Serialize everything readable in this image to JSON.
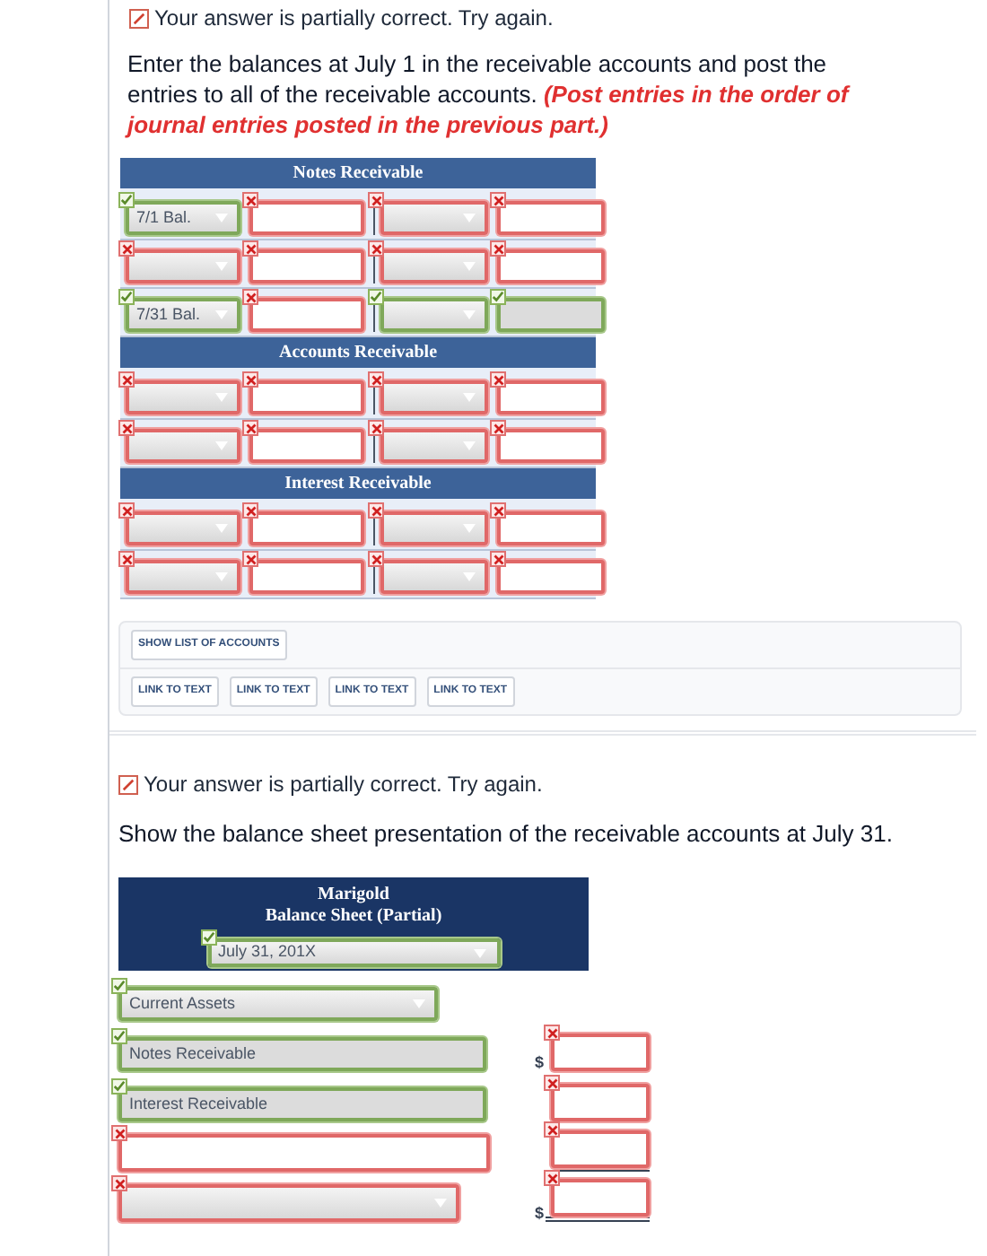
{
  "top_feedback": "Your answer is partially correct.  Try again.",
  "instructions": "Enter the balances at July 1 in the receivable accounts and post the entries to all of the receivable accounts. **(Post entries in the order of journal entries posted in the previous part.)**",
  "ledgers": [
    {
      "title": "Notes Receivable",
      "rows": [
        [
          {
            "kind": "select",
            "value": "7/1 Bal.",
            "correct": true
          },
          {
            "kind": "input",
            "correct": false
          },
          {
            "kind": "select",
            "correct": false
          },
          {
            "kind": "input",
            "correct": false
          }
        ],
        [
          {
            "kind": "select",
            "correct": false
          },
          {
            "kind": "input",
            "correct": false
          },
          {
            "kind": "select",
            "correct": false
          },
          {
            "kind": "input",
            "correct": false
          }
        ],
        [
          {
            "kind": "select",
            "value": "7/31 Bal.",
            "correct": true
          },
          {
            "kind": "input",
            "correct": false
          },
          {
            "kind": "select",
            "correct": true
          },
          {
            "kind": "input",
            "correct": true
          }
        ]
      ]
    },
    {
      "title": "Accounts Receivable",
      "rows": [
        [
          {
            "kind": "select",
            "correct": false
          },
          {
            "kind": "input",
            "correct": false
          },
          {
            "kind": "select",
            "correct": false
          },
          {
            "kind": "input",
            "correct": false
          }
        ],
        [
          {
            "kind": "select",
            "correct": false
          },
          {
            "kind": "input",
            "correct": false
          },
          {
            "kind": "select",
            "correct": false
          },
          {
            "kind": "input",
            "correct": false
          }
        ]
      ]
    },
    {
      "title": "Interest Receivable",
      "rows": [
        [
          {
            "kind": "select",
            "correct": false
          },
          {
            "kind": "input",
            "correct": false
          },
          {
            "kind": "select",
            "correct": false
          },
          {
            "kind": "input",
            "correct": false
          }
        ],
        [
          {
            "kind": "select",
            "correct": false
          },
          {
            "kind": "input",
            "correct": false
          },
          {
            "kind": "select",
            "correct": false
          },
          {
            "kind": "input",
            "correct": false
          }
        ]
      ]
    }
  ],
  "tool_buttons": [
    [
      "SHOW LIST OF ACCOUNTS"
    ],
    [
      "LINK TO TEXT",
      "LINK TO TEXT",
      "LINK TO TEXT",
      "LINK TO TEXT"
    ]
  ],
  "feedback": "Your answer is partially correct.  Try again.",
  "question": "Show the balance sheet presentation of the receivable accounts at July 31.",
  "balance_sheet": {
    "company": "Marigold",
    "title": "Balance Sheet (Partial)",
    "date": {
      "value": "July 31, 201X",
      "correct": true
    },
    "rows": [
      {
        "kind": "select",
        "value": "Current Assets",
        "correct": true
      },
      {
        "kind": "input",
        "value": "Notes Receivable",
        "correct": true,
        "amount": {
          "correct": false,
          "currency": "$",
          "underlined": false,
          "double_underlined": false
        }
      },
      {
        "kind": "input",
        "value": "Interest Receivable",
        "correct": true,
        "amount": {
          "correct": false,
          "underlined": false,
          "double_underlined": false
        }
      },
      {
        "kind": "input",
        "correct": false,
        "amount": {
          "correct": false,
          "underlined": true,
          "double_underlined": false
        }
      },
      {
        "kind": "select",
        "correct": false,
        "amount": {
          "correct": false,
          "currency": "$",
          "underlined": false,
          "double_underlined": true
        }
      }
    ]
  }
}
